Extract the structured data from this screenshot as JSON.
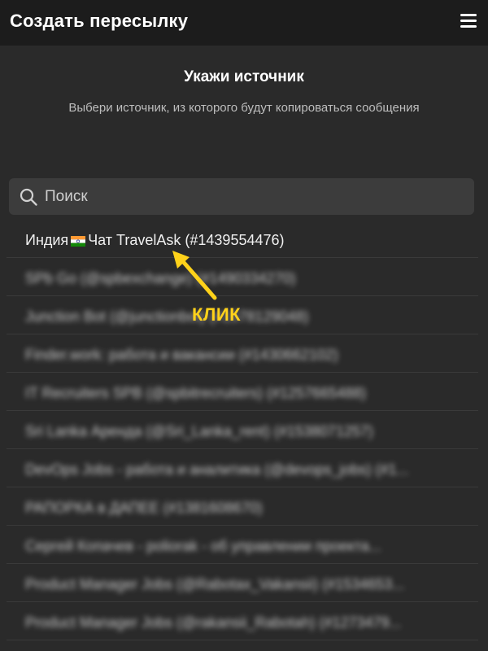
{
  "header": {
    "title": "Создать пересылку",
    "menu_icon": "hamburger-menu-icon"
  },
  "main": {
    "heading": "Укажи источник",
    "subtitle": "Выбери источник, из которого будут копироваться сообщения"
  },
  "search": {
    "placeholder": "Поиск",
    "value": "",
    "icon": "search-icon"
  },
  "list": {
    "items": [
      {
        "prefix": "Индия",
        "flag": "india-flag-icon",
        "suffix": "Чат TravelAsk (#1439554476)",
        "blurred": false
      },
      {
        "label": "SPb Go (@spbexchange) (#1490334270)",
        "blurred": true
      },
      {
        "label": "Junction Bot (@junctionbot) (#1578129048)",
        "blurred": true
      },
      {
        "label": "Finder.work: работа и вакансии (#1430662102)",
        "blurred": true
      },
      {
        "label": "IT Recruiters SPB (@spbitrecruiters) (#1257665488)",
        "blurred": true
      },
      {
        "label": "Sri Lanka Аренда (@Sri_Lanka_rent) (#1538071257)",
        "blurred": true
      },
      {
        "label": "DevOps Jobs - работа и аналитика (@devops_jobs) (#1...",
        "blurred": true
      },
      {
        "label": "PAПОРКА в ДАПЕЕ (#1381608670)",
        "blurred": true
      },
      {
        "label": "Сергей Копачев - poliorak - об управлении проекта...",
        "blurred": true
      },
      {
        "label": "Product Manager Jobs (@Rabotax_Vakansii) (#1534653...",
        "blurred": true
      },
      {
        "label": "Product Manager Jobs (@rakansii_Rabotah) (#1273479...",
        "blurred": true
      }
    ]
  },
  "annotation": {
    "label": "КЛИК",
    "color": "#ffd21a"
  },
  "colors": {
    "header_bg": "#1c1c1c",
    "page_bg": "#2a2a2a",
    "search_bg": "#3c3c3c",
    "accent": "#ffd21a"
  }
}
